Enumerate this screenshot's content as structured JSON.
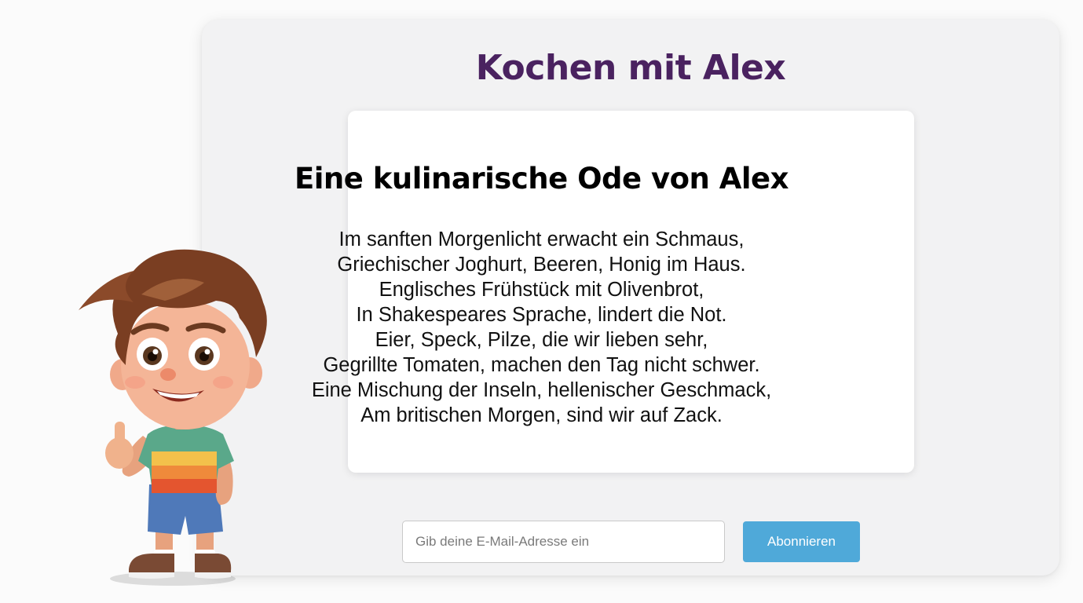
{
  "header": {
    "title": "Kochen mit Alex"
  },
  "poem": {
    "title": "Eine kulinarische Ode von Alex",
    "lines": [
      "Im sanften Morgenlicht erwacht ein Schmaus,",
      "Griechischer Joghurt, Beeren, Honig im Haus.",
      "Englisches Frühstück mit Olivenbrot,",
      "In Shakespeares Sprache, lindert die Not.",
      "Eier, Speck, Pilze, die wir lieben sehr,",
      "Gegrillte Tomaten, machen den Tag nicht schwer.",
      "Eine Mischung der Inseln, hellenischer Geschmack,",
      "Am britischen Morgen, sind wir auf Zack."
    ]
  },
  "subscribe": {
    "placeholder": "Gib deine E-Mail-Adresse ein",
    "button_label": "Abonnieren"
  },
  "colors": {
    "title": "#4a2260",
    "button": "#4fa9d9",
    "card_background": "#f2f2f3"
  },
  "mascot": {
    "icon": "cartoon-boy-thumbs-up-illustration"
  }
}
